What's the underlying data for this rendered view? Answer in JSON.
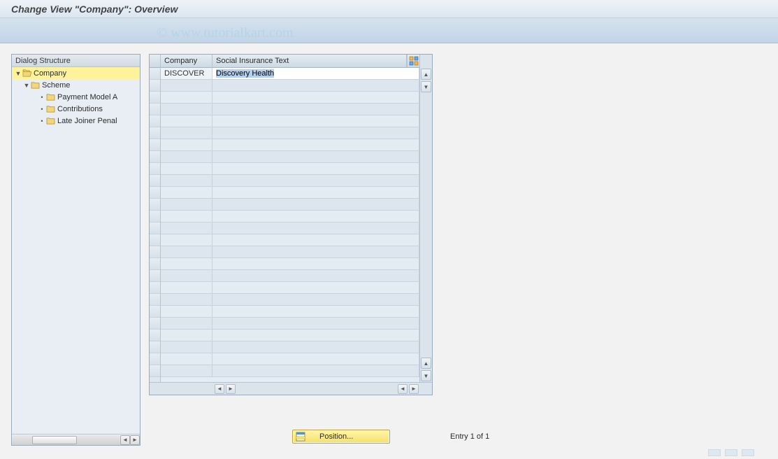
{
  "title": "Change View \"Company\": Overview",
  "watermark": "© www.tutorialkart.com",
  "tree": {
    "header": "Dialog Structure",
    "items": [
      {
        "label": "Company",
        "icon": "folder-open",
        "level": 0,
        "expander": "▼",
        "selected": true
      },
      {
        "label": "Scheme",
        "icon": "folder",
        "level": 1,
        "expander": "▼",
        "selected": false
      },
      {
        "label": "Payment Model A",
        "icon": "folder",
        "level": 2,
        "expander": "•",
        "selected": false
      },
      {
        "label": "Contributions",
        "icon": "folder",
        "level": 2,
        "expander": "•",
        "selected": false
      },
      {
        "label": "Late Joiner Penal",
        "icon": "folder",
        "level": 2,
        "expander": "•",
        "selected": false
      }
    ]
  },
  "table": {
    "columns": {
      "company": "Company",
      "sitext": "Social Insurance Text"
    },
    "rows": [
      {
        "company": "DISCOVER",
        "sitext": "Discovery Health",
        "editable_text_selected": true
      }
    ],
    "empty_row_count": 25,
    "config_icon": "table-settings-icon"
  },
  "position_button": {
    "label": "Position..."
  },
  "entry_status": "Entry 1 of 1"
}
